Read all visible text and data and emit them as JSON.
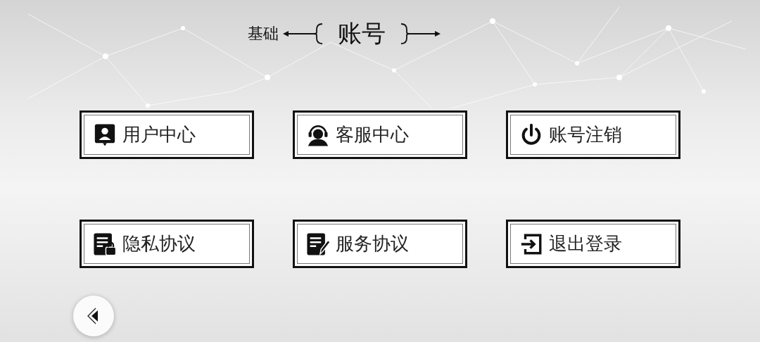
{
  "header": {
    "parent": "基础",
    "title": "账号"
  },
  "buttons": [
    {
      "label": "用户中心"
    },
    {
      "label": "客服中心"
    },
    {
      "label": "账号注销"
    },
    {
      "label": "隐私协议"
    },
    {
      "label": "服务协议"
    },
    {
      "label": "退出登录"
    }
  ]
}
